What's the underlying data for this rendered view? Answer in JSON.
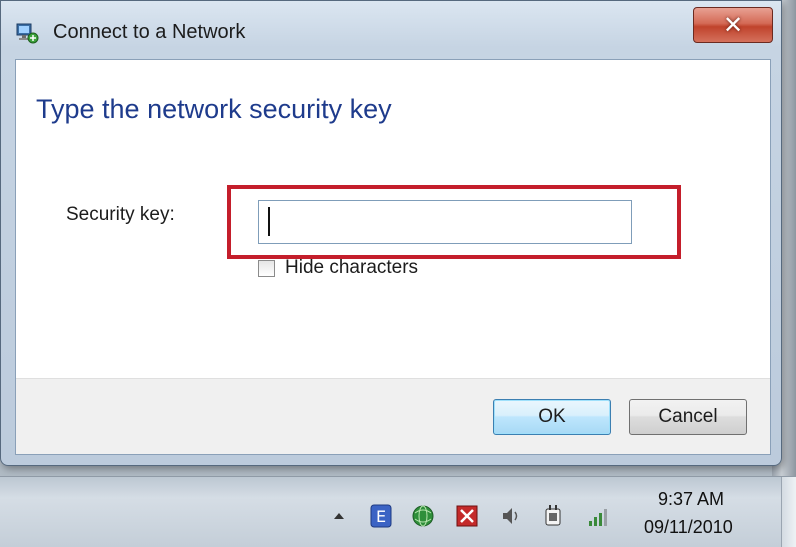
{
  "window": {
    "title": "Connect to a Network",
    "close_label": "✕"
  },
  "dialog": {
    "heading": "Type the network security key",
    "security_key_label": "Security key:",
    "security_key_value": "",
    "hide_characters_label": "Hide characters",
    "hide_characters_checked": false,
    "ok_label": "OK",
    "cancel_label": "Cancel"
  },
  "taskbar": {
    "tray_icons": [
      "show-hidden-icons-arrow",
      "e-app-icon",
      "network-globe-icon",
      "antivirus-shield-icon",
      "volume-icon",
      "power-plug-icon",
      "wireless-signal-icon"
    ],
    "clock_time": "9:37 AM",
    "clock_date": "09/11/2010"
  },
  "colors": {
    "heading": "#1e3b8c",
    "highlight": "#c41e2b",
    "close_button": "#c0432c"
  }
}
